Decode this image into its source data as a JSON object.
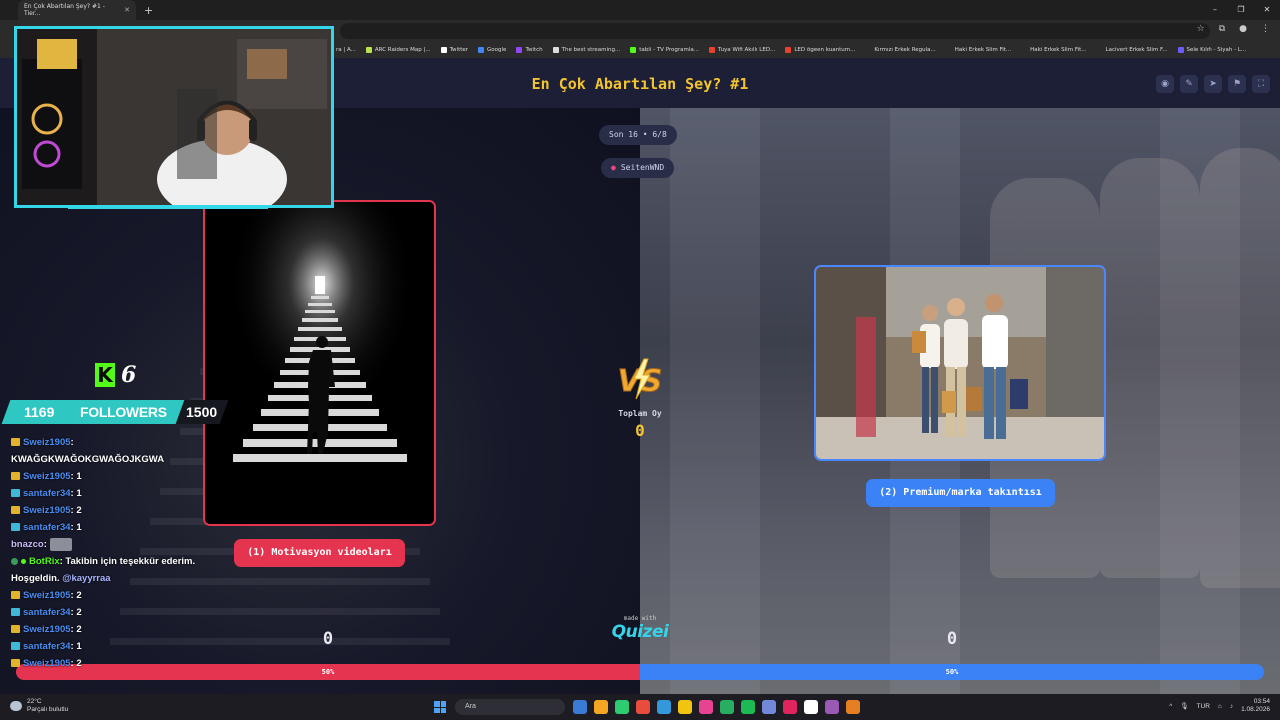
{
  "browser": {
    "tab_title": "En Çok Abartılan Şey? #1 - Tier...",
    "new_tab": "+",
    "window_controls": [
      "–",
      "❐",
      "✕"
    ],
    "bookmarks": [
      {
        "label": "ARC Raiders Map |...",
        "color": "#b9e34f"
      },
      {
        "label": "Twitter",
        "color": "#ffffff"
      },
      {
        "label": "Google",
        "color": "#4285f4"
      },
      {
        "label": "Twitch",
        "color": "#9146ff"
      },
      {
        "label": "The best streaming...",
        "color": "#dddddd"
      },
      {
        "label": "tabii - TV Programla...",
        "color": "#53fc18"
      },
      {
        "label": "Tuya Wifi Akıllı LED...",
        "color": "#e8412c"
      },
      {
        "label": "LED ögeen kuantum...",
        "color": "#e8412c"
      },
      {
        "label": "Kırmızı Erkek Regula...",
        "color": "#2b2b2b"
      },
      {
        "label": "Haki Erkek Slim Fit...",
        "color": "#2b2b2b"
      },
      {
        "label": "Haki Erkek Slim Fit...",
        "color": "#2b2b2b"
      },
      {
        "label": "Lacivert Erkek Slim F...",
        "color": "#2b2b2b"
      },
      {
        "label": "Sele Kılıfı - Siyah - L...",
        "color": "#6c5cff"
      }
    ],
    "bookmark_prefix": "ra | A..."
  },
  "quiz": {
    "title": "En Çok Abartılan Şey? #1",
    "round_label": "Son 16 • 6/8",
    "username": "SeitenWND",
    "left_option": "(1) Motivasyon videoları",
    "right_option": "(2) Premium/marka takıntısı",
    "total_label": "Toplam Oy",
    "total_value": "0",
    "left_count": "0",
    "right_count": "0",
    "left_percent": "50%",
    "right_percent": "50%",
    "made_with": "made with",
    "brand": "Quizei",
    "vs_text": "VS"
  },
  "overlay": {
    "kick_count": "6",
    "followers_current": "1169",
    "followers_label": "FOLLOWERS",
    "followers_goal": "1500"
  },
  "chat": [
    {
      "badge": "gold",
      "user": "Sweiz1905",
      "user_color": "blue",
      "text": ":"
    },
    {
      "badge": "",
      "user": "",
      "user_color": "",
      "text": "KWAĞGKWAĞOKGWAĞOJKGWA"
    },
    {
      "badge": "gold",
      "user": "Sweiz1905",
      "user_color": "blue",
      "text": ": 1"
    },
    {
      "badge": "teal",
      "user": "santafer34",
      "user_color": "blue",
      "text": ": 1"
    },
    {
      "badge": "gold",
      "user": "Sweiz1905",
      "user_color": "blue",
      "text": ": 2"
    },
    {
      "badge": "teal",
      "user": "santafer34",
      "user_color": "blue",
      "text": ": 1"
    },
    {
      "badge": "",
      "user": "bnazco",
      "user_color": "lav",
      "text": ":"
    },
    {
      "badge": "bot",
      "user": "BotRix",
      "user_color": "green",
      "text": ": Takibin için teşekkür ederim."
    },
    {
      "badge": "",
      "user": "",
      "user_color": "",
      "text": "Hoşgeldin.",
      "mention": "@kayyrraa"
    },
    {
      "badge": "gold",
      "user": "Sweiz1905",
      "user_color": "blue",
      "text": ": 2"
    },
    {
      "badge": "teal",
      "user": "santafer34",
      "user_color": "blue",
      "text": ": 2"
    },
    {
      "badge": "gold",
      "user": "Sweiz1905",
      "user_color": "blue",
      "text": ": 2"
    },
    {
      "badge": "teal",
      "user": "santafer34",
      "user_color": "blue",
      "text": ": 1"
    },
    {
      "badge": "gold",
      "user": "Sweiz1905",
      "user_color": "blue",
      "text": ": 2"
    }
  ],
  "taskbar": {
    "temperature": "22°C",
    "weather": "Parçalı bulutlu",
    "search_placeholder": "Ara",
    "language": "TUR",
    "time": "03:54",
    "date": "1.08.2026",
    "app_colors": [
      "#3a7bd5",
      "#f5a623",
      "#2ecc71",
      "#e74c3c",
      "#3498db",
      "#f1c40f",
      "#e84393",
      "#27ae60",
      "#1db954",
      "#7289da",
      "#e0245e",
      "#ffffff",
      "#9b59b6",
      "#e67e22"
    ]
  },
  "colors": {
    "accent_yellow": "#f4c430",
    "left_red": "#e5344f",
    "right_blue": "#3b82f6",
    "overlay_cyan": "#35d6e8",
    "kick_green": "#53fc18"
  }
}
